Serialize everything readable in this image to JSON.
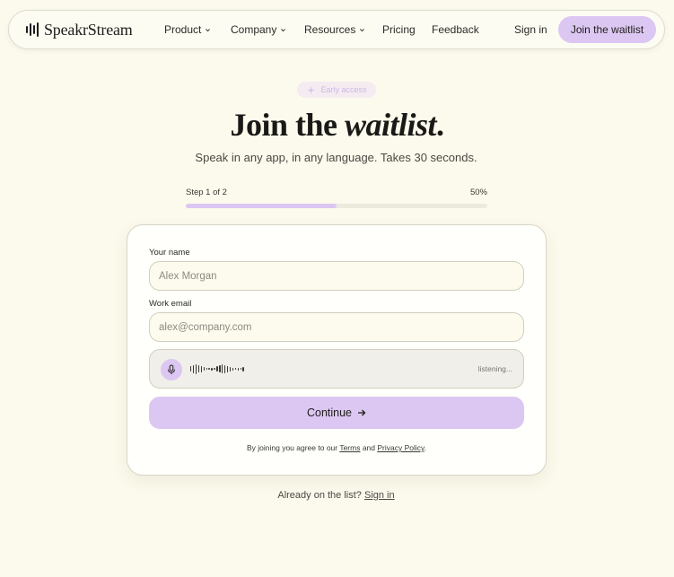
{
  "nav": {
    "brand": "SpeakrStream",
    "items": [
      {
        "label": "Product",
        "has_dropdown": true
      },
      {
        "label": "Company",
        "has_dropdown": true
      },
      {
        "label": "Resources",
        "has_dropdown": true
      },
      {
        "label": "Pricing",
        "has_dropdown": false
      },
      {
        "label": "Feedback",
        "has_dropdown": false
      }
    ],
    "signin_label": "Sign in",
    "cta_label": "Join the waitlist"
  },
  "hero": {
    "badge": "Early access",
    "headline_plain": "Join the ",
    "headline_italic": "waitlist",
    "headline_end": ".",
    "subhead": "Speak in any app, in any language. Takes 30 seconds."
  },
  "progress": {
    "step_label": "Step 1 of 2",
    "percent_label": "50%",
    "fraction": 0.5
  },
  "form": {
    "name_label": "Your name",
    "name_placeholder": "Alex Morgan",
    "email_label": "Work email",
    "email_placeholder": "alex@company.com",
    "voice_status": "listening...",
    "continue_label": "Continue",
    "terms_prefix": "By joining you agree to our ",
    "terms_link": "Terms",
    "terms_and": " and ",
    "privacy_link": "Privacy Policy",
    "terms_suffix": "."
  },
  "footer": {
    "prompt": "Already on the list? ",
    "signin_link": "Sign in"
  },
  "colors": {
    "background": "#fcfaec",
    "accent": "#dcc7f2",
    "text": "#1e1d1a"
  },
  "icons": {
    "logo": "waveform-icon",
    "dropdown": "chevron-down-icon",
    "badge": "sparkle-icon",
    "mic": "microphone-icon",
    "continue": "arrow-right-icon"
  }
}
